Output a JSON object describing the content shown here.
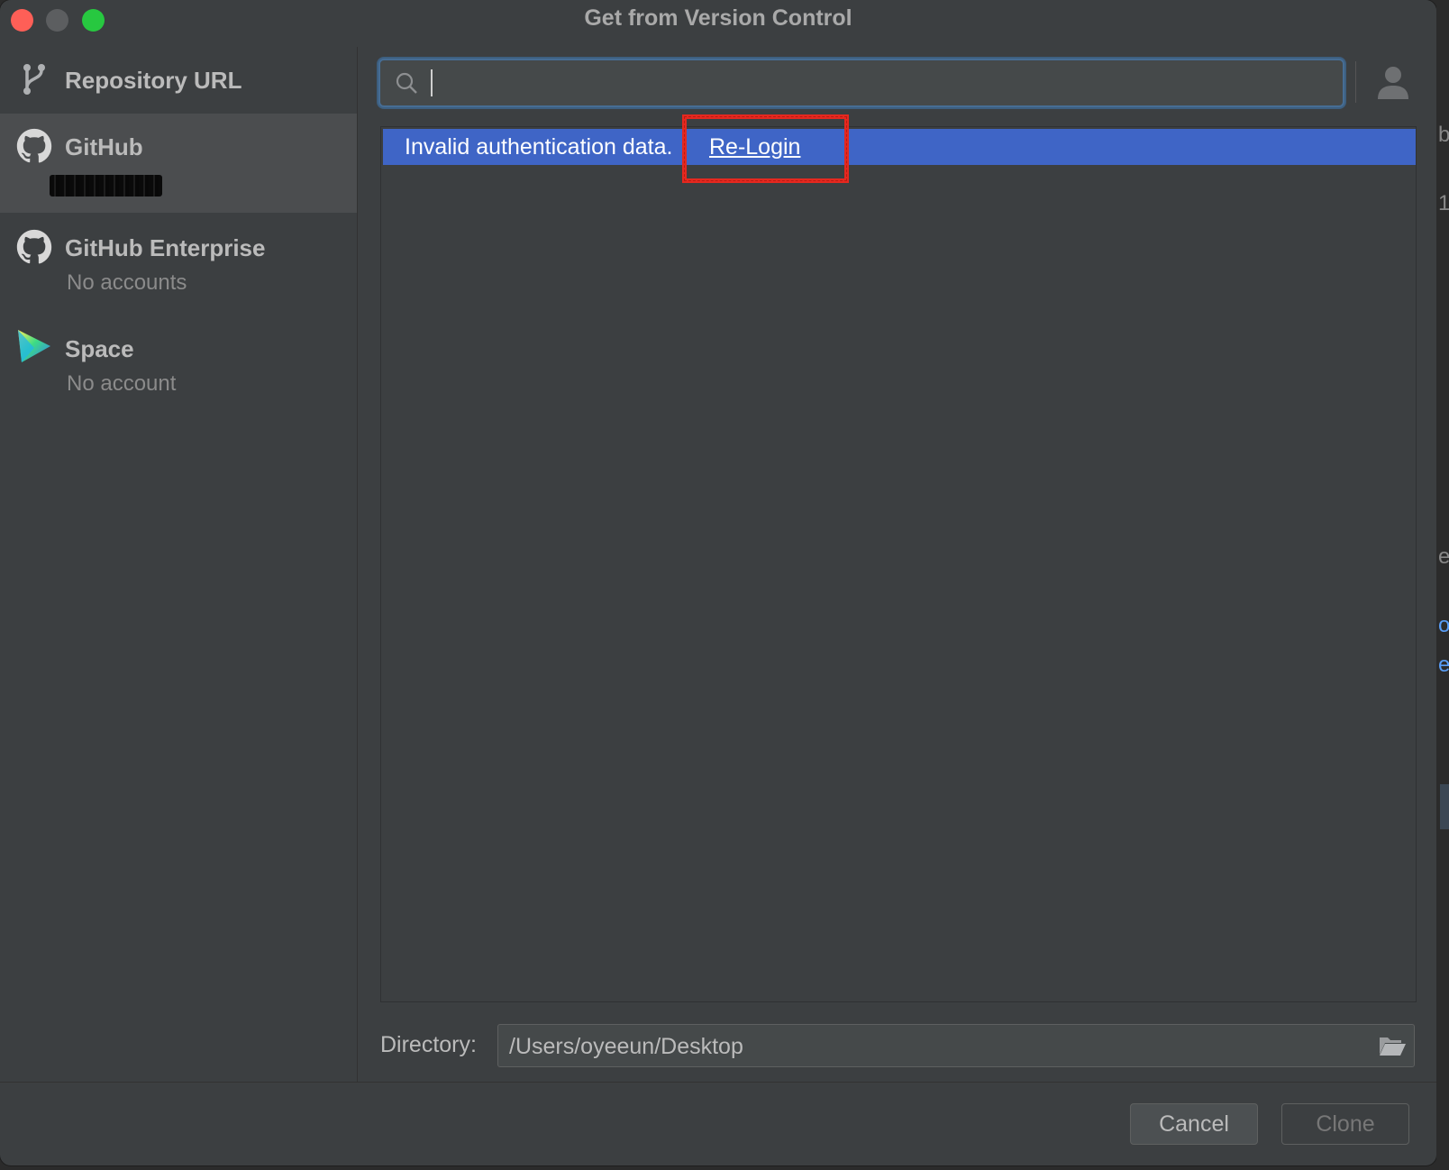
{
  "window": {
    "title": "Get from Version Control"
  },
  "sidebar": {
    "items": [
      {
        "title": "Repository URL",
        "subtitle": "",
        "icon": "branch-icon"
      },
      {
        "title": "GitHub",
        "subtitle": "",
        "icon": "github-icon"
      },
      {
        "title": "GitHub Enterprise",
        "subtitle": "No accounts",
        "icon": "github-icon"
      },
      {
        "title": "Space",
        "subtitle": "No account",
        "icon": "space-logo-icon"
      }
    ]
  },
  "search": {
    "value": "",
    "placeholder": ""
  },
  "error": {
    "message": "Invalid authentication data.",
    "link_label": "Re-Login"
  },
  "directory": {
    "label": "Directory:",
    "value": "/Users/oyeeun/Desktop"
  },
  "buttons": {
    "cancel": "Cancel",
    "clone": "Clone"
  },
  "colors": {
    "accent": "#3f65c6",
    "focus_border": "#466d94",
    "highlight_box": "#e5281f",
    "close": "#fe5f57",
    "maximize": "#27c840"
  }
}
